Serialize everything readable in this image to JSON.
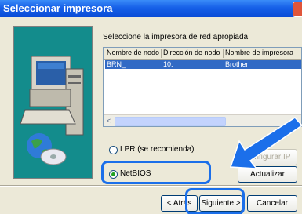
{
  "window": {
    "title": "Seleccionar impresora"
  },
  "prompt": "Seleccione la impresora de red apropiada.",
  "list": {
    "columns": [
      "Nombre de nodo",
      "Dirección de nodo",
      "Nombre de impresora"
    ],
    "rows": [
      {
        "node_name": "BRN_",
        "node_address": "10.",
        "printer_name": "Brother"
      }
    ],
    "scroll_left_glyph": "<"
  },
  "options": {
    "lpr_label": "LPR (se recomienda)",
    "netbios_label": "NetBIOS",
    "selected": "NetBIOS"
  },
  "buttons": {
    "configure_ip": "Configurar IP",
    "refresh": "Actualizar",
    "back": "< Atrás",
    "next": "Siguiente >",
    "cancel": "Cancelar"
  },
  "colors": {
    "accent": "#1B6FEA",
    "selection": "#316AC5",
    "title": "#0A4BD6"
  }
}
